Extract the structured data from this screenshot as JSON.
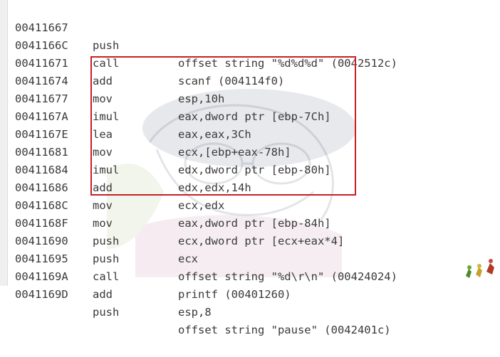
{
  "listing": {
    "rows": [
      {
        "addr": "00411667",
        "op": "push",
        "arg": "offset string \"%d%d%d\" (0042512c)"
      },
      {
        "addr": "0041166C",
        "op": "call",
        "arg": "scanf (004114f0)"
      },
      {
        "addr": "00411671",
        "op": "add",
        "arg": "esp,10h"
      },
      {
        "addr": "00411674",
        "op": "mov",
        "arg": "eax,dword ptr [ebp-7Ch]"
      },
      {
        "addr": "00411677",
        "op": "imul",
        "arg": "eax,eax,3Ch"
      },
      {
        "addr": "0041167A",
        "op": "lea",
        "arg": "ecx,[ebp+eax-78h]"
      },
      {
        "addr": "0041167E",
        "op": "mov",
        "arg": "edx,dword ptr [ebp-80h]"
      },
      {
        "addr": "00411681",
        "op": "imul",
        "arg": "edx,edx,14h"
      },
      {
        "addr": "00411684",
        "op": "add",
        "arg": "ecx,edx"
      },
      {
        "addr": "00411686",
        "op": "mov",
        "arg": "eax,dword ptr [ebp-84h]"
      },
      {
        "addr": "0041168C",
        "op": "mov",
        "arg": "ecx,dword ptr [ecx+eax*4]"
      },
      {
        "addr": "0041168F",
        "op": "push",
        "arg": "ecx"
      },
      {
        "addr": "00411690",
        "op": "push",
        "arg": "offset string \"%d\\r\\n\" (00424024)"
      },
      {
        "addr": "00411695",
        "op": "call",
        "arg": "printf (00401260)"
      },
      {
        "addr": "0041169A",
        "op": "add",
        "arg": "esp,8"
      },
      {
        "addr": "0041169D",
        "op": "push",
        "arg": "offset string \"pause\" (0042401c)"
      }
    ]
  },
  "highlight": {
    "color": "#c81e24"
  }
}
